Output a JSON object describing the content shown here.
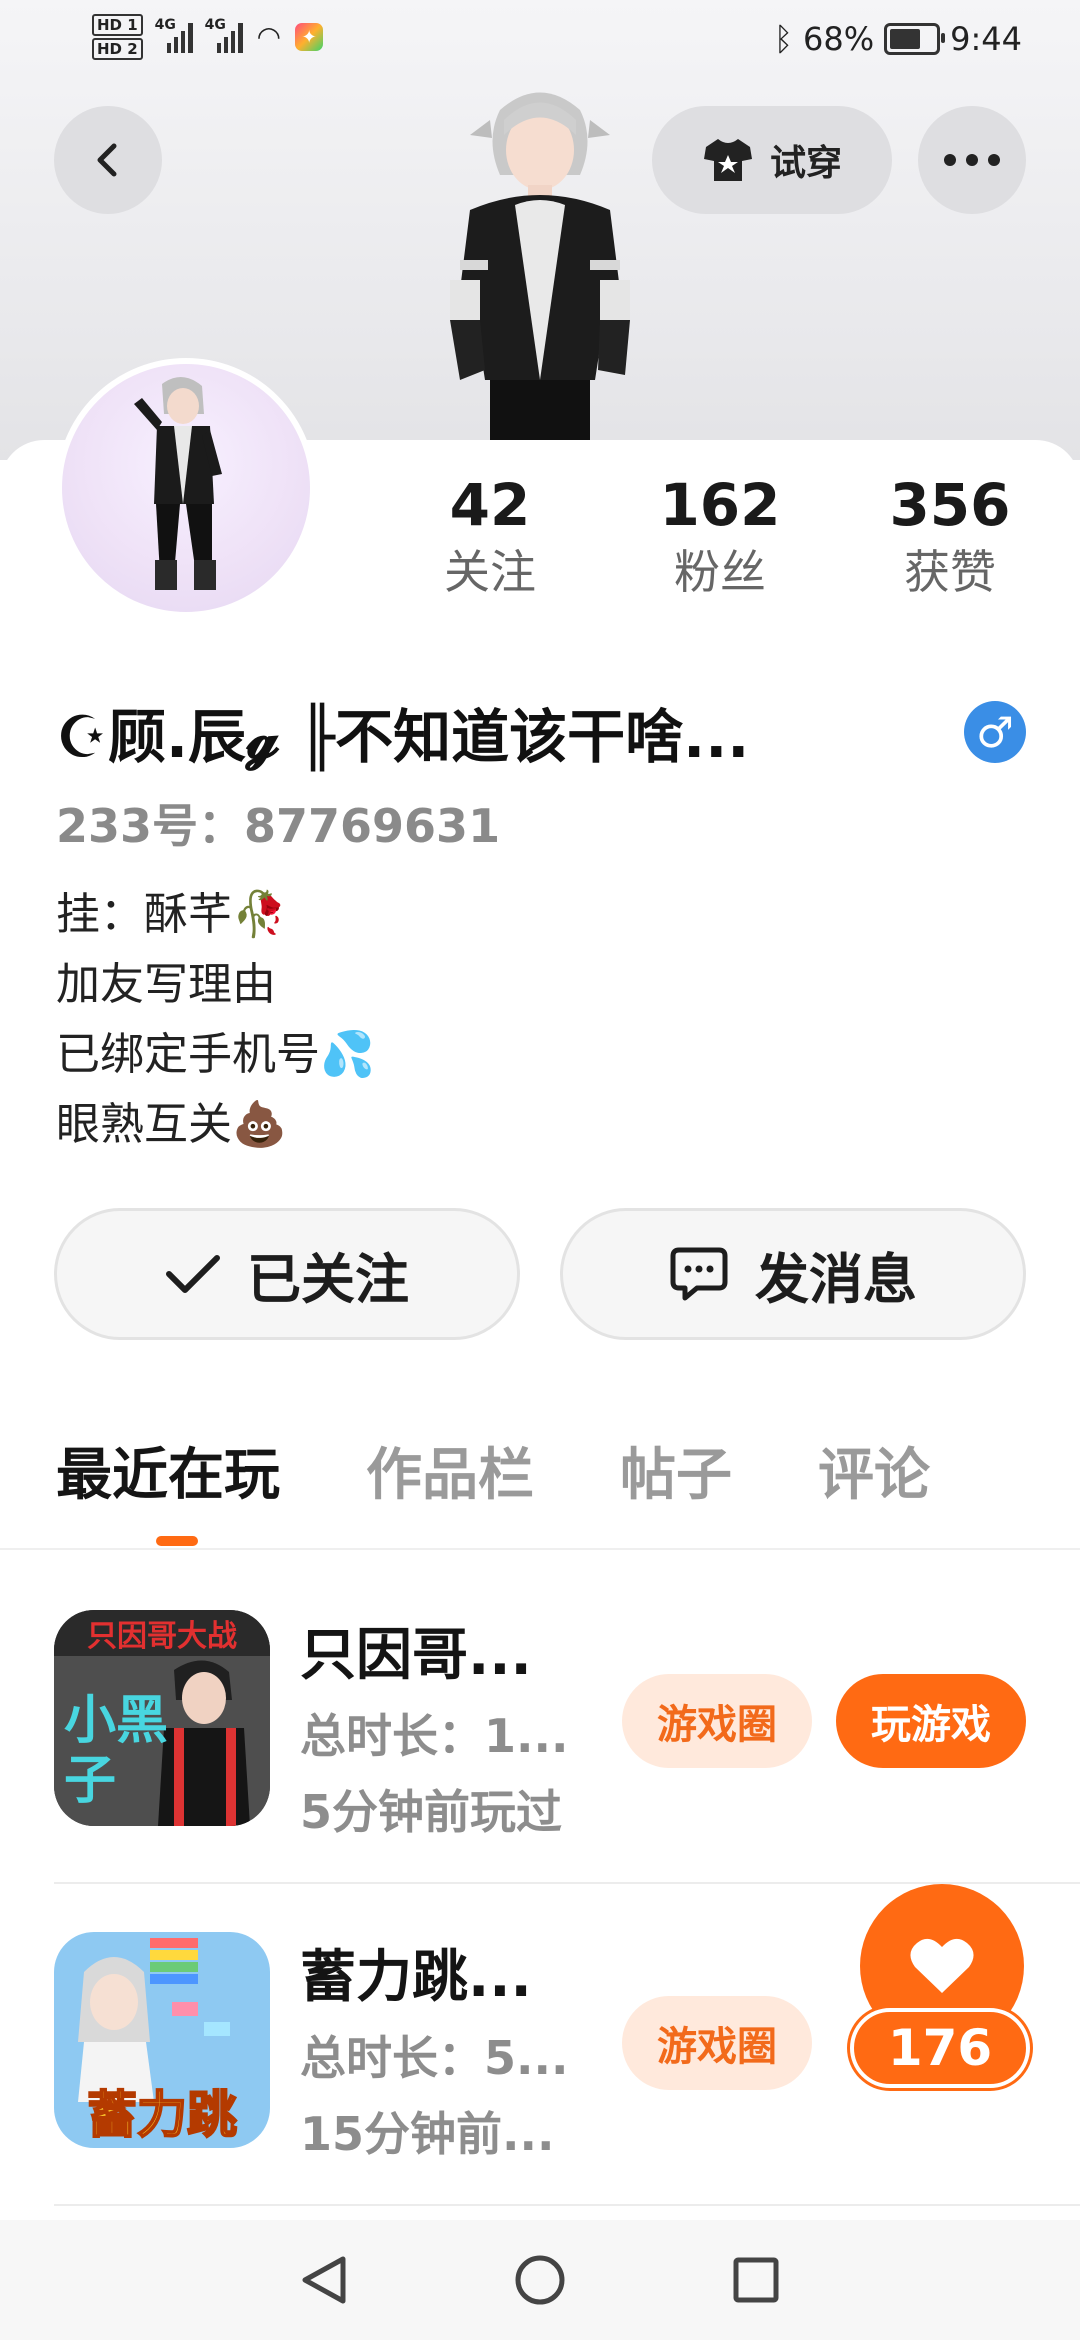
{
  "status_bar": {
    "hd1": "HD 1",
    "hd2": "HD 2",
    "net1": "4G",
    "net2": "4G",
    "battery": "68%",
    "time": "9:44"
  },
  "header": {
    "try_on_label": "试穿"
  },
  "stats": [
    {
      "value": "42",
      "label": "关注"
    },
    {
      "value": "162",
      "label": "粉丝"
    },
    {
      "value": "356",
      "label": "获赞"
    }
  ],
  "profile": {
    "name": "☪顾.辰𝓰 ╟不知道该干啥...",
    "gender_symbol": "♂",
    "uid": "233号：87769631",
    "bio": [
      "挂：酥芊🥀",
      "加友写理由",
      "已绑定手机号💦",
      "眼熟互关💩"
    ]
  },
  "actions": {
    "followed_label": "已关注",
    "message_label": "发消息"
  },
  "tabs": [
    "最近在玩",
    "作品栏",
    "帖子",
    "评论"
  ],
  "games": [
    {
      "title": "只因哥...",
      "duration": "总时长：1...",
      "last_played": "5分钟前玩过",
      "circle_label": "游戏圈",
      "play_label": "玩游戏",
      "thumb_text_top": "只因哥大战",
      "thumb_text_main": "小黑子"
    },
    {
      "title": "蓄力跳...",
      "duration": "总时长：5...",
      "last_played": "15分钟前...",
      "circle_label": "游戏圈",
      "thumb_text_main": "蓄力跳"
    }
  ],
  "like": {
    "count": "176"
  },
  "colors": {
    "accent": "#ff6a13",
    "gender_blue": "#3a8ee6"
  }
}
